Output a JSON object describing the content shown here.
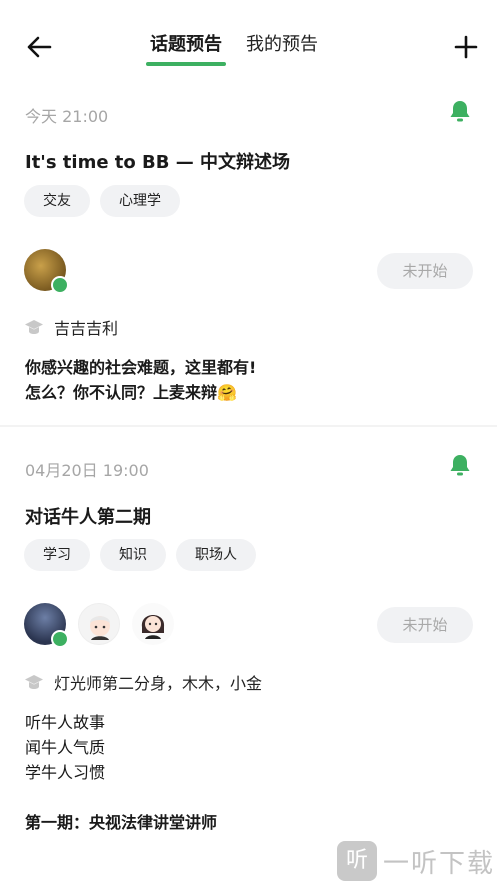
{
  "header": {
    "tabs": [
      {
        "label": "话题预告",
        "active": true
      },
      {
        "label": "我的预告",
        "active": false
      }
    ]
  },
  "cards": [
    {
      "time": "今天 21:00",
      "title": "It's time to BB — 中文辩述场",
      "tags": [
        "交友",
        "心理学"
      ],
      "status": "未开始",
      "hosts": "吉吉吉利",
      "desc_lines": [
        "你感兴趣的社会难题，这里都有!",
        "怎么？你不认同？上麦来辩🤗"
      ]
    },
    {
      "time": "04月20日 19:00",
      "title": "对话牛人第二期",
      "tags": [
        "学习",
        "知识",
        "职场人"
      ],
      "status": "未开始",
      "hosts": "灯光师第二分身，木木，小金",
      "desc_lines": [
        "听牛人故事",
        "闻牛人气质",
        "学牛人习惯"
      ],
      "desc_extra": "第一期：央视法律讲堂讲师"
    }
  ],
  "watermark": {
    "logo": "听",
    "text": "一听下载"
  },
  "colors": {
    "accent": "#3db061",
    "muted": "#a6a6a6",
    "chip_bg": "#f1f2f4"
  }
}
